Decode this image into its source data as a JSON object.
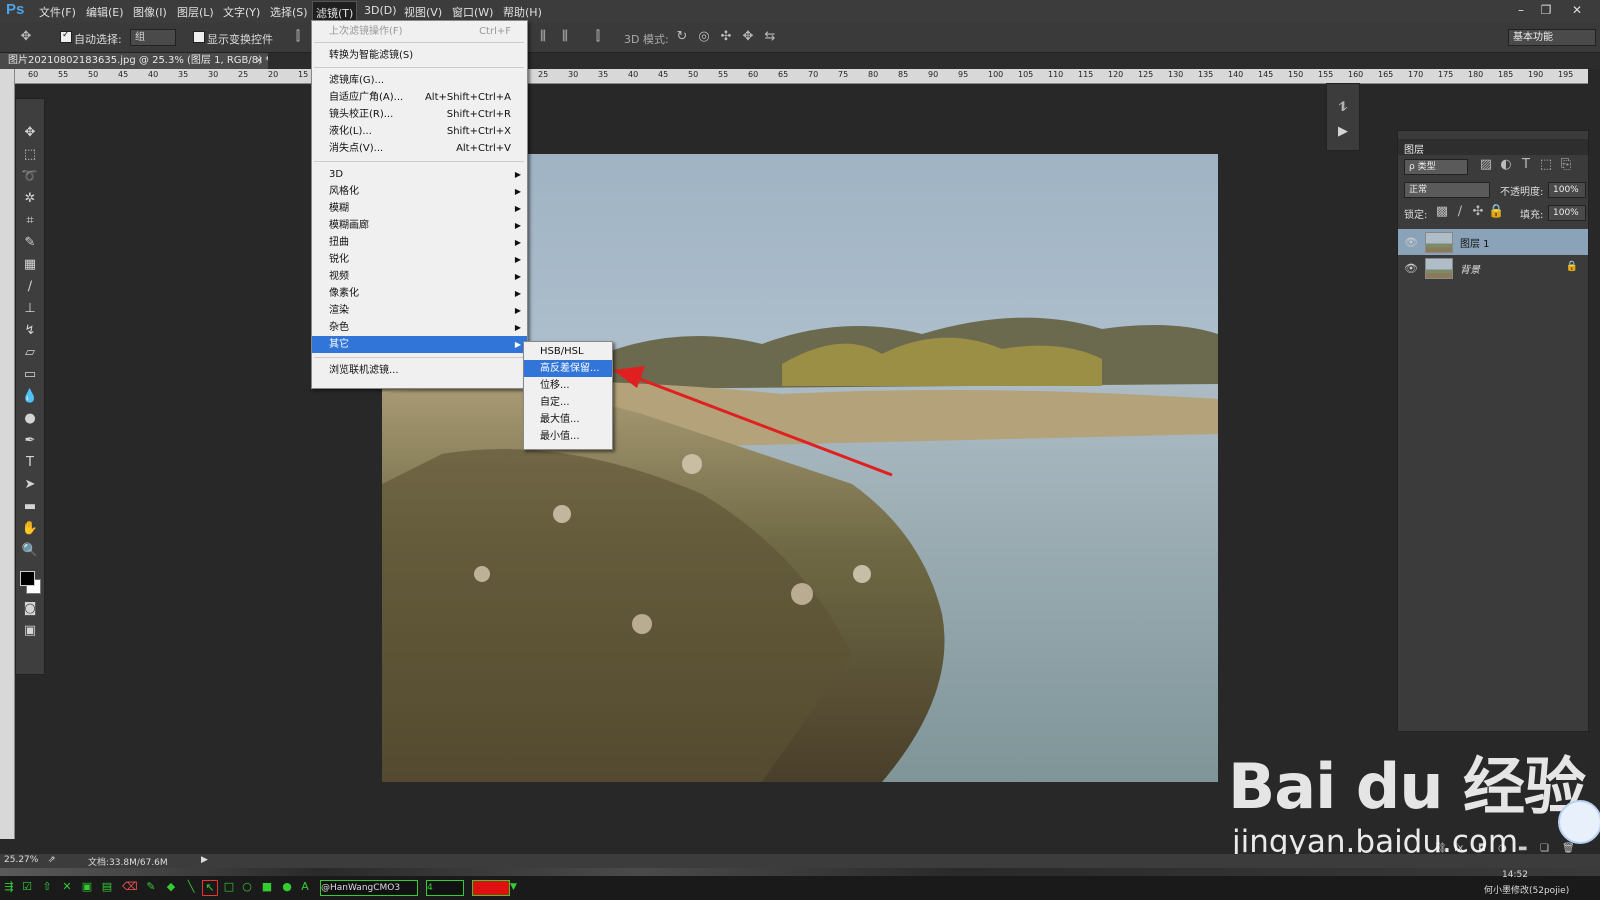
{
  "app": {
    "logo": "Ps"
  },
  "menubar": {
    "items": [
      "文件(F)",
      "编辑(E)",
      "图像(I)",
      "图层(L)",
      "文字(Y)",
      "选择(S)",
      "滤镜(T)",
      "3D(D)",
      "视图(V)",
      "窗口(W)",
      "帮助(H)"
    ],
    "active": "滤镜(T)"
  },
  "options": {
    "auto_select_label": "自动选择:",
    "auto_select_value": "组",
    "show_transform_label": "显示变换控件",
    "mode_3d_label": "3D 模式:",
    "workspace": "基本功能"
  },
  "document": {
    "tab_title": "图片20210802183635.jpg @ 25.3% (图层 1, RGB/8) *",
    "close": "×",
    "zoom": "25.27%",
    "doc_size": "文档:33.8M/67.6M"
  },
  "ruler": {
    "top_ticks": [
      "60",
      "55",
      "50",
      "45",
      "40",
      "35",
      "30",
      "25",
      "20",
      "15",
      "10",
      "5",
      "0",
      "5",
      "10",
      "15",
      "20",
      "25",
      "30",
      "35",
      "40",
      "45",
      "50",
      "55",
      "60",
      "65",
      "70",
      "75",
      "80",
      "85",
      "90",
      "95",
      "100",
      "105",
      "110",
      "115",
      "120",
      "125",
      "130",
      "135",
      "140",
      "145",
      "150",
      "155",
      "160",
      "165",
      "170",
      "175",
      "180",
      "185",
      "190",
      "195"
    ]
  },
  "filter_menu": {
    "last_filter": {
      "label": "上次滤镜操作(F)",
      "shortcut": "Ctrl+F"
    },
    "smart": "转换为智能滤镜(S)",
    "group2": [
      {
        "label": "滤镜库(G)...",
        "shortcut": ""
      },
      {
        "label": "自适应广角(A)...",
        "shortcut": "Alt+Shift+Ctrl+A"
      },
      {
        "label": "镜头校正(R)...",
        "shortcut": "Shift+Ctrl+R"
      },
      {
        "label": "液化(L)...",
        "shortcut": "Shift+Ctrl+X"
      },
      {
        "label": "消失点(V)...",
        "shortcut": "Alt+Ctrl+V"
      }
    ],
    "submenus": [
      "3D",
      "风格化",
      "模糊",
      "模糊画廊",
      "扭曲",
      "锐化",
      "视频",
      "像素化",
      "渲染",
      "杂色",
      "其它"
    ],
    "highlighted": "其它",
    "browse": "浏览联机滤镜..."
  },
  "sub_menu": {
    "items": [
      "HSB/HSL",
      "高反差保留...",
      "位移...",
      "自定...",
      "最大值...",
      "最小值..."
    ],
    "highlighted": "高反差保留..."
  },
  "layers_panel": {
    "title": "图层",
    "filter_kind": "ρ 类型",
    "blend_mode": "正常",
    "opacity_label": "不透明度:",
    "opacity": "100%",
    "lock_label": "锁定:",
    "fill_label": "填充:",
    "fill": "100%",
    "layers": [
      {
        "name": "图层 1",
        "selected": true,
        "locked": false
      },
      {
        "name": "背景",
        "selected": false,
        "locked": true
      }
    ],
    "bottom_icons": [
      "link-icon",
      "fx-icon",
      "mask-icon",
      "adjustment-icon",
      "group-icon",
      "new-layer-icon",
      "trash-icon"
    ],
    "fx_label": "fx."
  },
  "taskbar": {
    "font_name": "@HanWangCMO3",
    "size_value": "4",
    "time": "14:52",
    "right_text": "何小墨修改(52pojie)"
  },
  "watermark": {
    "brand": "Bai du 经验",
    "site": "jingyan.baidu.com"
  },
  "colors": {
    "menu_highlight": "#3275d8",
    "arrow": "#e02020",
    "ps_blue": "#4ea3e6"
  }
}
